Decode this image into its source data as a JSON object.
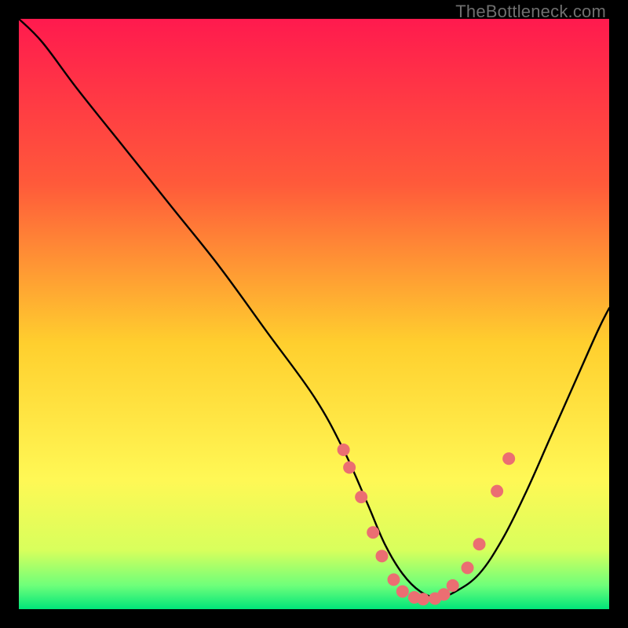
{
  "watermark": "TheBottleneck.com",
  "chart_data": {
    "type": "line",
    "title": "",
    "xlabel": "",
    "ylabel": "",
    "xlim": [
      0,
      100
    ],
    "ylim": [
      0,
      100
    ],
    "grid": false,
    "legend": false,
    "background_gradient": {
      "stops": [
        {
          "offset": 0.0,
          "color": "#ff1a4e"
        },
        {
          "offset": 0.28,
          "color": "#ff5a3a"
        },
        {
          "offset": 0.55,
          "color": "#ffcf2e"
        },
        {
          "offset": 0.78,
          "color": "#fff855"
        },
        {
          "offset": 0.9,
          "color": "#d8ff5c"
        },
        {
          "offset": 0.96,
          "color": "#6eff7a"
        },
        {
          "offset": 1.0,
          "color": "#00e57a"
        }
      ]
    },
    "series": [
      {
        "name": "bottleneck-curve",
        "x": [
          0,
          4,
          10,
          18,
          26,
          34,
          42,
          50,
          55,
          59,
          62,
          65,
          68,
          71,
          74,
          78,
          82,
          86,
          90,
          94,
          98,
          100
        ],
        "y": [
          100,
          96,
          88,
          78,
          68,
          58,
          47,
          36,
          27,
          18,
          11,
          6,
          3,
          2,
          3,
          6,
          12,
          20,
          29,
          38,
          47,
          51
        ]
      }
    ],
    "markers": [
      {
        "x": 55.0,
        "y": 27.0
      },
      {
        "x": 56.0,
        "y": 24.0
      },
      {
        "x": 58.0,
        "y": 19.0
      },
      {
        "x": 60.0,
        "y": 13.0
      },
      {
        "x": 61.5,
        "y": 9.0
      },
      {
        "x": 63.5,
        "y": 5.0
      },
      {
        "x": 65.0,
        "y": 3.0
      },
      {
        "x": 67.0,
        "y": 2.0
      },
      {
        "x": 68.5,
        "y": 1.7
      },
      {
        "x": 70.5,
        "y": 1.8
      },
      {
        "x": 72.0,
        "y": 2.5
      },
      {
        "x": 73.5,
        "y": 4.0
      },
      {
        "x": 76.0,
        "y": 7.0
      },
      {
        "x": 78.0,
        "y": 11.0
      },
      {
        "x": 81.0,
        "y": 20.0
      },
      {
        "x": 83.0,
        "y": 25.5
      }
    ],
    "marker_style": {
      "color": "#eb6e72",
      "radius_px": 8
    }
  }
}
